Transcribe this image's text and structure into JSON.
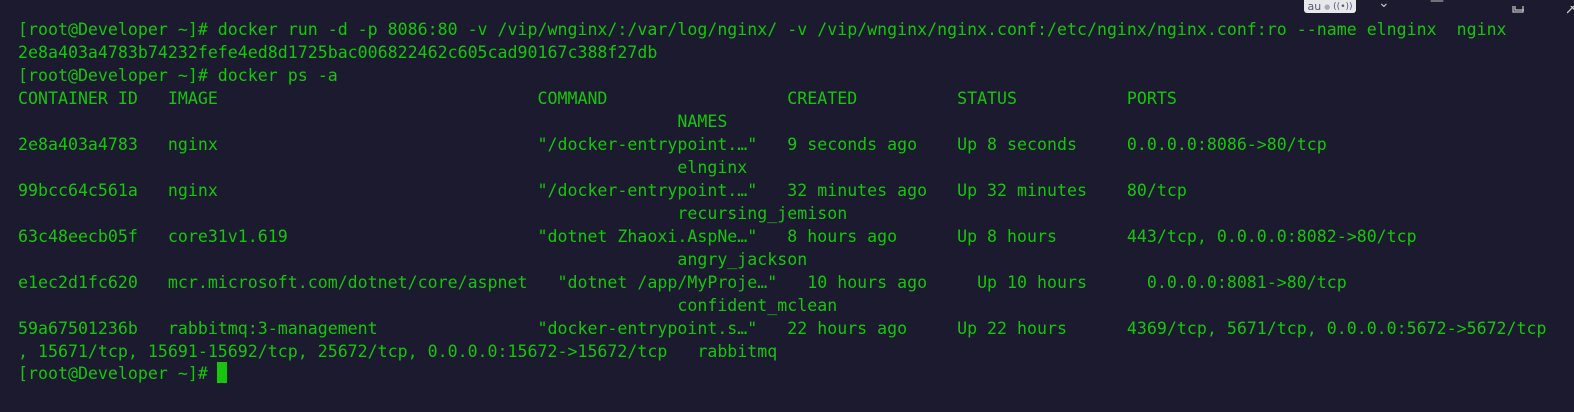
{
  "terminal": {
    "lines": [
      "[root@Developer ~]# docker run -d -p 8086:80 -v /vip/wnginx/:/var/log/nginx/ -v /vip/wnginx/nginx.conf:/etc/nginx/nginx.conf:ro --name elnginx  nginx",
      "2e8a403a4783b74232fefe4ed8d1725bac006822462c605cad90167c388f27db",
      "[root@Developer ~]# docker ps -a",
      "CONTAINER ID   IMAGE                                COMMAND                  CREATED          STATUS           PORTS",
      "                                                                  NAMES",
      "2e8a403a4783   nginx                                \"/docker-entrypoint.…\"   9 seconds ago    Up 8 seconds     0.0.0.0:8086->80/tcp",
      "                                                                  elnginx",
      "99bcc64c561a   nginx                                \"/docker-entrypoint.…\"   32 minutes ago   Up 32 minutes    80/tcp",
      "                                                                  recursing_jemison",
      "63c48eecb05f   core31v1.619                         \"dotnet Zhaoxi.AspNe…\"   8 hours ago      Up 8 hours       443/tcp, 0.0.0.0:8082->80/tcp",
      "                                                                  angry_jackson",
      "e1ec2d1fc620   mcr.microsoft.com/dotnet/core/aspnet   \"dotnet /app/MyProje…\"   10 hours ago     Up 10 hours      0.0.0.0:8081->80/tcp",
      "                                                                  confident_mclean",
      "59a67501236b   rabbitmq:3-management                \"docker-entrypoint.s…\"   22 hours ago     Up 22 hours      4369/tcp, 5671/tcp, 0.0.0.0:5672->5672/tcp",
      ", 15671/tcp, 15691-15692/tcp, 25672/tcp, 0.0.0.0:15672->15672/tcp   rabbitmq",
      "[root@Developer ~]# "
    ]
  },
  "ime_indicator": "au",
  "colors": {
    "background": "#1b1a2e",
    "text": "#16c60c"
  }
}
